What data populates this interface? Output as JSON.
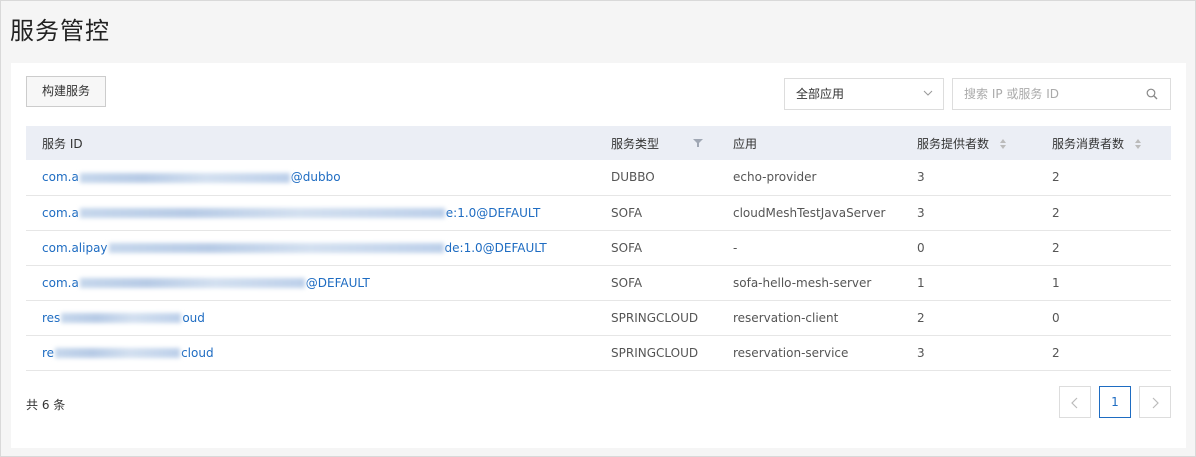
{
  "page_title": "服务管控",
  "toolbar": {
    "create_label": "构建服务",
    "app_select_value": "全部应用",
    "search_placeholder": "搜索 IP 或服务 ID"
  },
  "table": {
    "headers": [
      "服务 ID",
      "服务类型",
      "应用",
      "服务提供者数",
      "服务消费者数"
    ],
    "rows": [
      {
        "id_prefix": "com.a",
        "id_suffix": "@dubbo",
        "type": "DUBBO",
        "app": "echo-provider",
        "providers": "3",
        "consumers": "2"
      },
      {
        "id_prefix": "com.a",
        "id_suffix": "e:1.0@DEFAULT",
        "type": "SOFA",
        "app": "cloudMeshTestJavaServer",
        "providers": "3",
        "consumers": "2"
      },
      {
        "id_prefix": "com.alipay",
        "id_suffix": "de:1.0@DEFAULT",
        "type": "SOFA",
        "app": "-",
        "providers": "0",
        "consumers": "2"
      },
      {
        "id_prefix": "com.a",
        "id_suffix": "@DEFAULT",
        "type": "SOFA",
        "app": "sofa-hello-mesh-server",
        "providers": "1",
        "consumers": "1"
      },
      {
        "id_prefix": "res",
        "id_suffix": "oud",
        "type": "SPRINGCLOUD",
        "app": "reservation-client",
        "providers": "2",
        "consumers": "0"
      },
      {
        "id_prefix": "re",
        "id_suffix": "cloud",
        "type": "SPRINGCLOUD",
        "app": "reservation-service",
        "providers": "3",
        "consumers": "2"
      }
    ]
  },
  "footer": {
    "total_label": "共 6 条",
    "current_page": "1"
  }
}
